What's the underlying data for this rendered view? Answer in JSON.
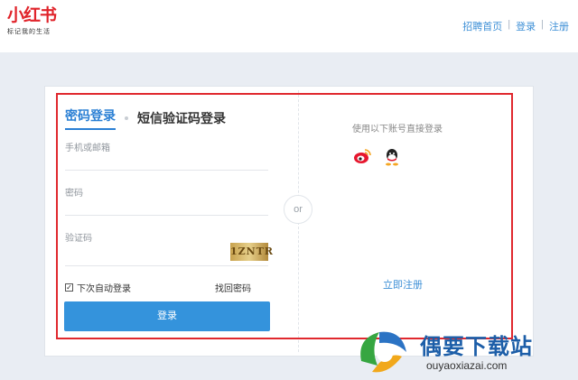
{
  "brand": {
    "name": "小红书",
    "slogan": "标记我的生活",
    "color": "#e0232a"
  },
  "topnav": {
    "recruit": "招聘首页",
    "login": "登录",
    "register": "注册",
    "separator": "|"
  },
  "tabs": {
    "password_login": "密码登录",
    "sms_login": "短信验证码登录"
  },
  "form": {
    "account_label": "手机或邮箱",
    "password_label": "密码",
    "captcha_label": "验证码",
    "captcha_text": "1ZNTR",
    "remember_label": "下次自动登录",
    "forgot_label": "找回密码",
    "login_button": "登录"
  },
  "divider": {
    "or": "or"
  },
  "social": {
    "title": "使用以下账号直接登录",
    "icons": [
      "weibo-icon",
      "qq-icon"
    ]
  },
  "register": {
    "label": "立即注册"
  },
  "watermark": {
    "title": "偶要下载站",
    "url": "ouyaoxiazai.com"
  },
  "colors": {
    "accent": "#3493dc",
    "highlight_border": "#e0282e"
  }
}
